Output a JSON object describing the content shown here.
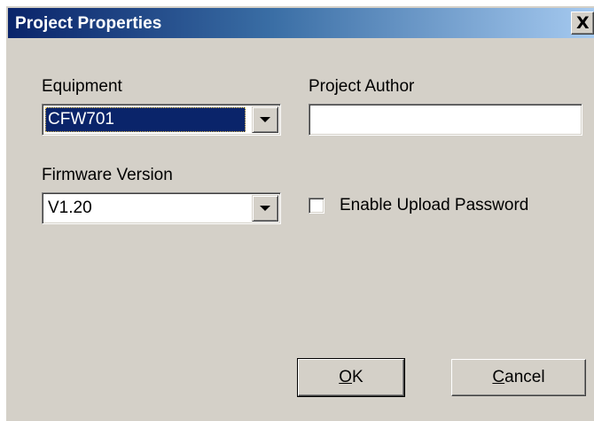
{
  "window": {
    "title": "Project Properties",
    "close_glyph": "X",
    "colors": {
      "title_start": "#0a246a",
      "title_end": "#a6caf0",
      "face": "#d4d0c8",
      "selection": "#0a246a"
    }
  },
  "equipment": {
    "label": "Equipment",
    "value": "CFW701",
    "focused": true
  },
  "project_author": {
    "label": "Project Author",
    "value": ""
  },
  "firmware": {
    "label": "Firmware Version",
    "value": "V1.20"
  },
  "upload_password": {
    "label": "Enable Upload Password",
    "checked": false
  },
  "buttons": {
    "ok": "OK",
    "cancel": "Cancel"
  },
  "icons": {
    "close": "close-icon",
    "dropdown": "chevron-down-icon"
  }
}
